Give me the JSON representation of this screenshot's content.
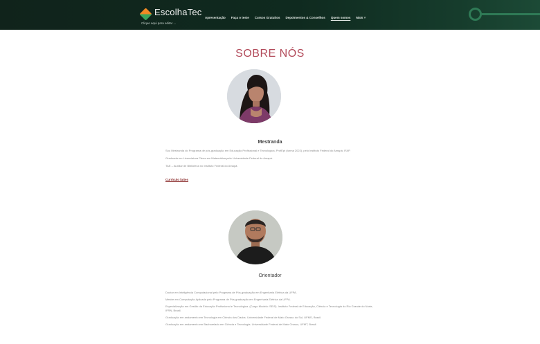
{
  "header": {
    "brand": "EscolhaTec",
    "subtitle": "Clique aqui para editar ...",
    "nav": [
      {
        "label": "Apresentação"
      },
      {
        "label": "Faça o teste"
      },
      {
        "label": "Cursos Gratuitos"
      },
      {
        "label": "Depoimentos & Conselhos"
      },
      {
        "label": "Quem somos"
      },
      {
        "label": "Mais ˅"
      }
    ],
    "colors": {
      "bar": "#10231b",
      "accent": "#2f7a56",
      "title": "#b24a5a"
    }
  },
  "page": {
    "title": "SOBRE NÓS"
  },
  "people": [
    {
      "role": "Mestranda",
      "bio": [
        "Sou Mestranda do Programa de pós-graduação em Educação Profissional e Tecnológica, ProfEpt (turma 2022), pelo Instituto Federal do Amapá, IFAP.",
        "Graduada em Licenciatura Plena em Matemática pela Universidade Federal do Amapá.",
        "TAE – Auxiliar de Biblioteca no Instituto Federal do Amapá."
      ],
      "link": "Currículo lattes"
    },
    {
      "role": "Orientador",
      "bio": [
        "Doutor em Inteligência Computacional pelo Programa de Pós-graduação em Engenharia Elétrica da UFPA.",
        "Mestre em Computação Aplicada pelo Programa de Pós-graduação em Engenharia Elétrica da UFPA.",
        "Especialização em Gestão da Educação Profissional e Tecnológica. (Cargo Modelo: SEIS). Instituto Federal de Educação, Ciência e Tecnologia do Rio Grande do Norte, IFRN, Brasil.",
        "Graduação em andamento em Tecnologia em Ciência dos Dados. Universidade Federal de Mato Grosso do Sul, UFMS, Brasil.",
        "Graduação em andamento em Bacharelado em Ciência e Tecnologia. Universidade Federal de Mato Grosso, UFMT, Brasil."
      ]
    }
  ]
}
